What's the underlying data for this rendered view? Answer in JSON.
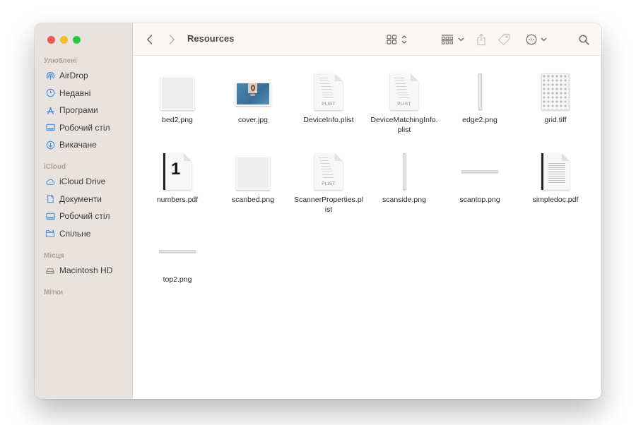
{
  "window": {
    "title": "Resources",
    "traffic_lights": [
      "close",
      "minimize",
      "zoom"
    ]
  },
  "toolbar": {
    "back_icon": "chevron-left-icon",
    "forward_icon": "chevron-right-icon",
    "title": "Resources",
    "view_icon": "icon-grid-icon",
    "group_icon": "group-by-icon",
    "share_icon": "share-icon",
    "tag_icon": "tag-icon",
    "actions_icon": "ellipsis-circle-icon",
    "search_icon": "search-icon"
  },
  "sidebar": {
    "sections": [
      {
        "heading": "Улюблені",
        "items": [
          {
            "label": "AirDrop",
            "icon": "airdrop-icon"
          },
          {
            "label": "Недавні",
            "icon": "clock-icon"
          },
          {
            "label": "Програми",
            "icon": "applications-icon"
          },
          {
            "label": "Робочий стіл",
            "icon": "desktop-icon"
          },
          {
            "label": "Викачане",
            "icon": "download-icon"
          }
        ]
      },
      {
        "heading": "iCloud",
        "items": [
          {
            "label": "iCloud Drive",
            "icon": "cloud-icon"
          },
          {
            "label": "Документи",
            "icon": "document-icon"
          },
          {
            "label": "Робочий стіл",
            "icon": "desktop-icon"
          },
          {
            "label": "Спільне",
            "icon": "shared-folder-icon"
          }
        ]
      },
      {
        "heading": "Місця",
        "items": [
          {
            "label": "Macintosh HD",
            "icon": "hard-drive-icon"
          }
        ]
      },
      {
        "heading": "Мітки",
        "items": []
      }
    ]
  },
  "files": [
    {
      "name": "bed2.png",
      "kind": "blank-image"
    },
    {
      "name": "cover.jpg",
      "kind": "photo"
    },
    {
      "name": "DeviceInfo.plist",
      "kind": "plist",
      "badge": "PLIST"
    },
    {
      "name": "DeviceMatchingInfo.plist",
      "kind": "plist",
      "badge": "PLIST"
    },
    {
      "name": "edge2.png",
      "kind": "vertical-strip"
    },
    {
      "name": "grid.tiff",
      "kind": "grid"
    },
    {
      "name": "numbers.pdf",
      "kind": "pdf-number",
      "glyph": "1"
    },
    {
      "name": "scanbed.png",
      "kind": "blank-image"
    },
    {
      "name": "ScannerProperties.plist",
      "kind": "plist",
      "badge": "PLIST"
    },
    {
      "name": "scanside.png",
      "kind": "vertical-strip"
    },
    {
      "name": "scantop.png",
      "kind": "horizontal-strip"
    },
    {
      "name": "simpledoc.pdf",
      "kind": "pdf-doc"
    },
    {
      "name": "top2.png",
      "kind": "horizontal-strip"
    }
  ]
}
